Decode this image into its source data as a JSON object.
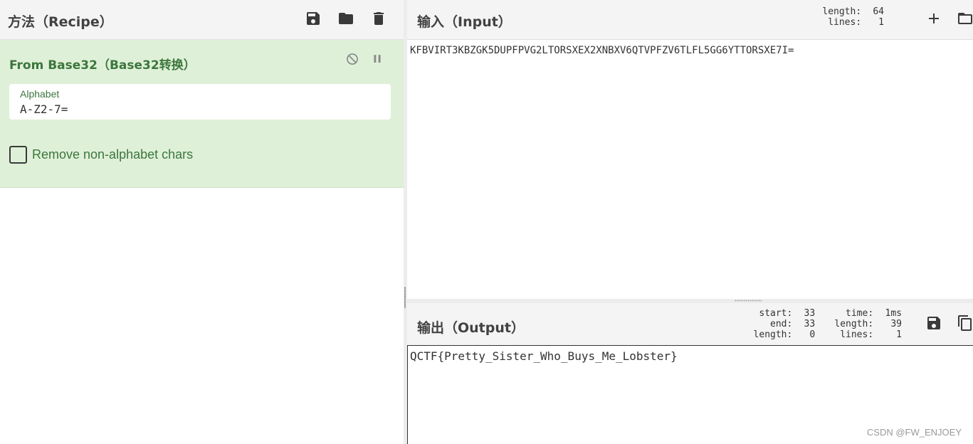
{
  "recipe": {
    "title": "方法（Recipe）",
    "operation": {
      "title": "From Base32（Base32转换）",
      "alphabet_label": "Alphabet",
      "alphabet_value": "A-Z2-7=",
      "remove_label": "Remove non-alphabet chars",
      "remove_checked": false
    }
  },
  "input": {
    "title": "输入（Input）",
    "stats": [
      {
        "key": "length:",
        "value": "64"
      },
      {
        "key": "lines:",
        "value": "1"
      }
    ],
    "text": "KFBVIRT3KBZGK5DUPFPVG2LTORSXEX2XNBXV6QTVPFZV6TLFL5GG6YTTORSXE7I="
  },
  "output": {
    "title": "输出（Output）",
    "stats": [
      {
        "key": "start:",
        "value": "33",
        "key2": "time:",
        "value2": "1ms"
      },
      {
        "key": "end:",
        "value": "33",
        "key2": "length:",
        "value2": "39"
      },
      {
        "key": "length:",
        "value": "0",
        "key2": "lines:",
        "value2": "1"
      }
    ],
    "text": "QCTF{Pretty_Sister_Who_Buys_Me_Lobster}"
  },
  "watermark": "CSDN @FW_ENJOEY",
  "colors": {
    "op_background": "#dff0d8",
    "op_text": "#3c763d",
    "header_background": "#f4f4f4"
  },
  "icons": [
    "save-icon",
    "folder-icon",
    "trash-icon",
    "disable-icon",
    "pause-icon",
    "plus-icon",
    "copy-icon"
  ]
}
